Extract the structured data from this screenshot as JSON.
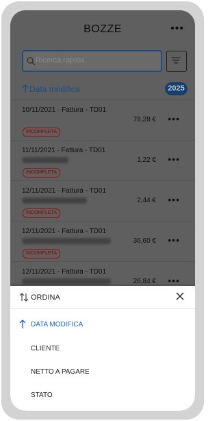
{
  "header": {
    "title": "BOZZE",
    "more_label": "•••"
  },
  "search": {
    "placeholder": "Ricerca rapida"
  },
  "sort_bar": {
    "label": "Data modifica",
    "year": "2025"
  },
  "colors": {
    "accent": "#1a66c8",
    "badge_red": "#c0392b",
    "year_badge": "#2062b0"
  },
  "drafts": [
    {
      "date_doc": "10/11/2021 · Fattura - TD01",
      "amount": "78,28 €",
      "status": "INCOMPLETA",
      "more": "•••"
    },
    {
      "date_doc": "11/11/2021 · Fattura - TD01",
      "amount": "1,22 €",
      "status": "INCOMPLETA",
      "more": "•••"
    },
    {
      "date_doc": "12/11/2021 · Fattura - TD01",
      "amount": "2,44 €",
      "status": "INCOMPLETA",
      "more": "•••"
    },
    {
      "date_doc": "12/11/2021 · Fattura - TD01",
      "amount": "36,60 €",
      "status": "INCOMPLETA",
      "more": "•••"
    },
    {
      "date_doc": "12/11/2021 · Fattura - TD01",
      "amount": "26,84 €",
      "status": "",
      "more": "•••"
    }
  ],
  "sort_sheet": {
    "title": "ORDINA",
    "options": [
      {
        "label": "DATA MODIFICA",
        "active": true
      },
      {
        "label": "CLIENTE",
        "active": false
      },
      {
        "label": "NETTO A PAGARE",
        "active": false
      },
      {
        "label": "STATO",
        "active": false
      }
    ]
  }
}
